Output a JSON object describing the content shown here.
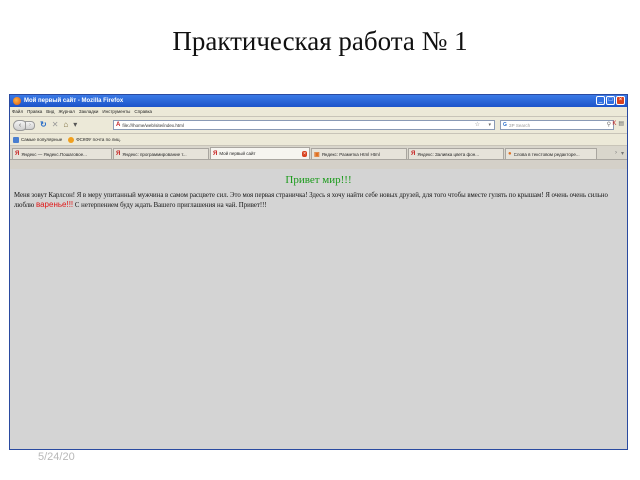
{
  "slide": {
    "title": "Практическая работа № 1",
    "date": "5/24/20"
  },
  "browser": {
    "window_title": "Мой первый сайт - Mozilla Firefox",
    "menu": [
      "Файл",
      "Правка",
      "Вид",
      "Журнал",
      "Закладки",
      "Инструменты",
      "Справка"
    ],
    "url": "file:///home/web/site/index.html",
    "search_placeholder": "ЗР Search",
    "bookmarks": [
      {
        "label": "Самые популярные",
        "icon": "bookmark-icon"
      },
      {
        "label": "ФСКФУ почта по лиц.",
        "icon": "globe-icon"
      }
    ],
    "tabs": [
      {
        "label": "Яндекс — Яндекс.Пошаговое...",
        "icon": "yandex-icon",
        "active": false
      },
      {
        "label": "Яндекс: программирование т...",
        "icon": "yandex-icon",
        "active": false
      },
      {
        "label": "Мой первый сайт",
        "icon": "yandex-icon",
        "active": true
      },
      {
        "label": "Яндекс: Разметка Html Html",
        "icon": "page-icon",
        "active": false
      },
      {
        "label": "Яндекс: Заливка цвета фон...",
        "icon": "yandex-icon",
        "active": false
      },
      {
        "label": "Слова в текстовом редакторе...",
        "icon": "page-icon",
        "active": false
      }
    ]
  },
  "page": {
    "heading": "Привет мир!!!",
    "paragraph_start": "Меня зовут Карлсон! Я в меру упитанный мужчина в самом расцвете сил. Это моя первая страничка! Здесь я хочу найти себе новых друзей, для того чтобы вместе гулять по крышам! Я очень очень сильно люблю",
    "highlight": "варенье!!!",
    "paragraph_end": "С нетерпением буду ждать Вашего приглашения на чай. Привет!!!"
  },
  "colors": {
    "heading": "#1a9a1a",
    "highlight": "#e01818",
    "content_bg": "#d4d4d4",
    "titlebar": "#1c53c9"
  }
}
